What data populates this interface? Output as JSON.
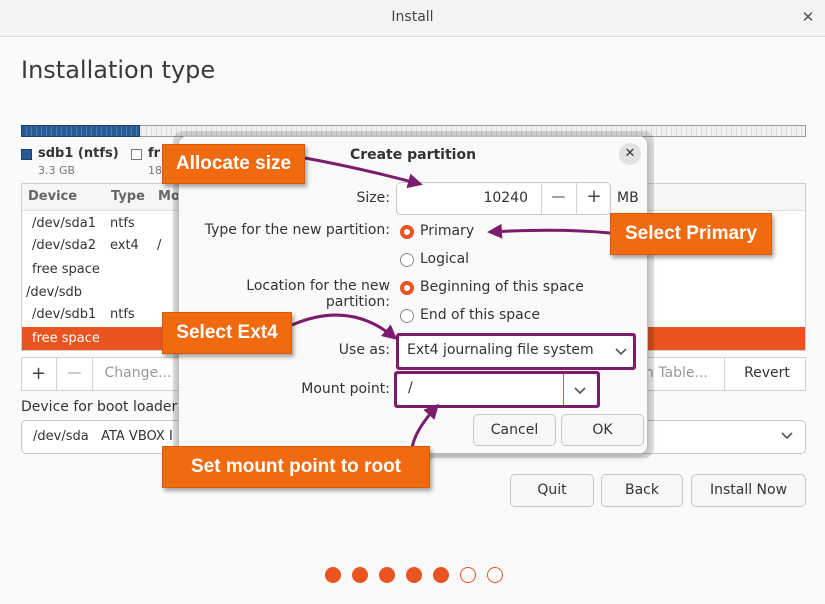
{
  "window": {
    "title": "Install"
  },
  "page": {
    "title": "Installation type"
  },
  "legend": [
    {
      "name": "sdb1 (ntfs)",
      "size": "3.3 GB",
      "color": "#2a5a93"
    },
    {
      "name": "fr",
      "size": "18",
      "color": "#ffffff"
    }
  ],
  "table": {
    "headers": [
      "Device",
      "Type",
      "Mo"
    ],
    "rows": [
      {
        "device": "/dev/sda1",
        "type": "ntfs",
        "mount": ""
      },
      {
        "device": "/dev/sda2",
        "type": "ext4",
        "mount": "/"
      },
      {
        "device": "free space",
        "type": "",
        "mount": ""
      },
      {
        "device": "/dev/sdb",
        "type": "",
        "mount": ""
      },
      {
        "device": "/dev/sdb1",
        "type": "ntfs",
        "mount": ""
      },
      {
        "device": "free space",
        "type": "",
        "mount": ""
      }
    ],
    "selected_index": 5
  },
  "toolbar": {
    "add": "+",
    "remove": "—",
    "change": "Change...",
    "new_table": "n Table...",
    "revert": "Revert"
  },
  "bootloader": {
    "label": "Device for boot loader i",
    "value": "/dev/sda   ATA VBOX I"
  },
  "buttons": {
    "quit": "Quit",
    "back": "Back",
    "install_now": "Install Now"
  },
  "steps": {
    "total": 7,
    "completed": 5
  },
  "dialog": {
    "title": "Create partition",
    "size_label": "Size:",
    "size_value": "10240",
    "size_unit": "MB",
    "minus": "—",
    "plus": "+",
    "type_label": "Type for the new partition:",
    "type_options": [
      "Primary",
      "Logical"
    ],
    "type_selected": "Primary",
    "location_label": "Location for the new partition:",
    "location_options": [
      "Beginning of this space",
      "End of this space"
    ],
    "location_selected": "Beginning of this space",
    "use_as_label": "Use as:",
    "use_as_value": "Ext4 journaling file system",
    "mount_label": "Mount point:",
    "mount_value": "/",
    "cancel": "Cancel",
    "ok": "OK"
  },
  "annotations": {
    "allocate": "Allocate size",
    "primary": "Select Primary",
    "ext4": "Select Ext4",
    "mount": "Set mount point to root"
  },
  "colors": {
    "accent": "#e95420",
    "callout": "#f26a10",
    "highlight": "#7b1c6c"
  }
}
